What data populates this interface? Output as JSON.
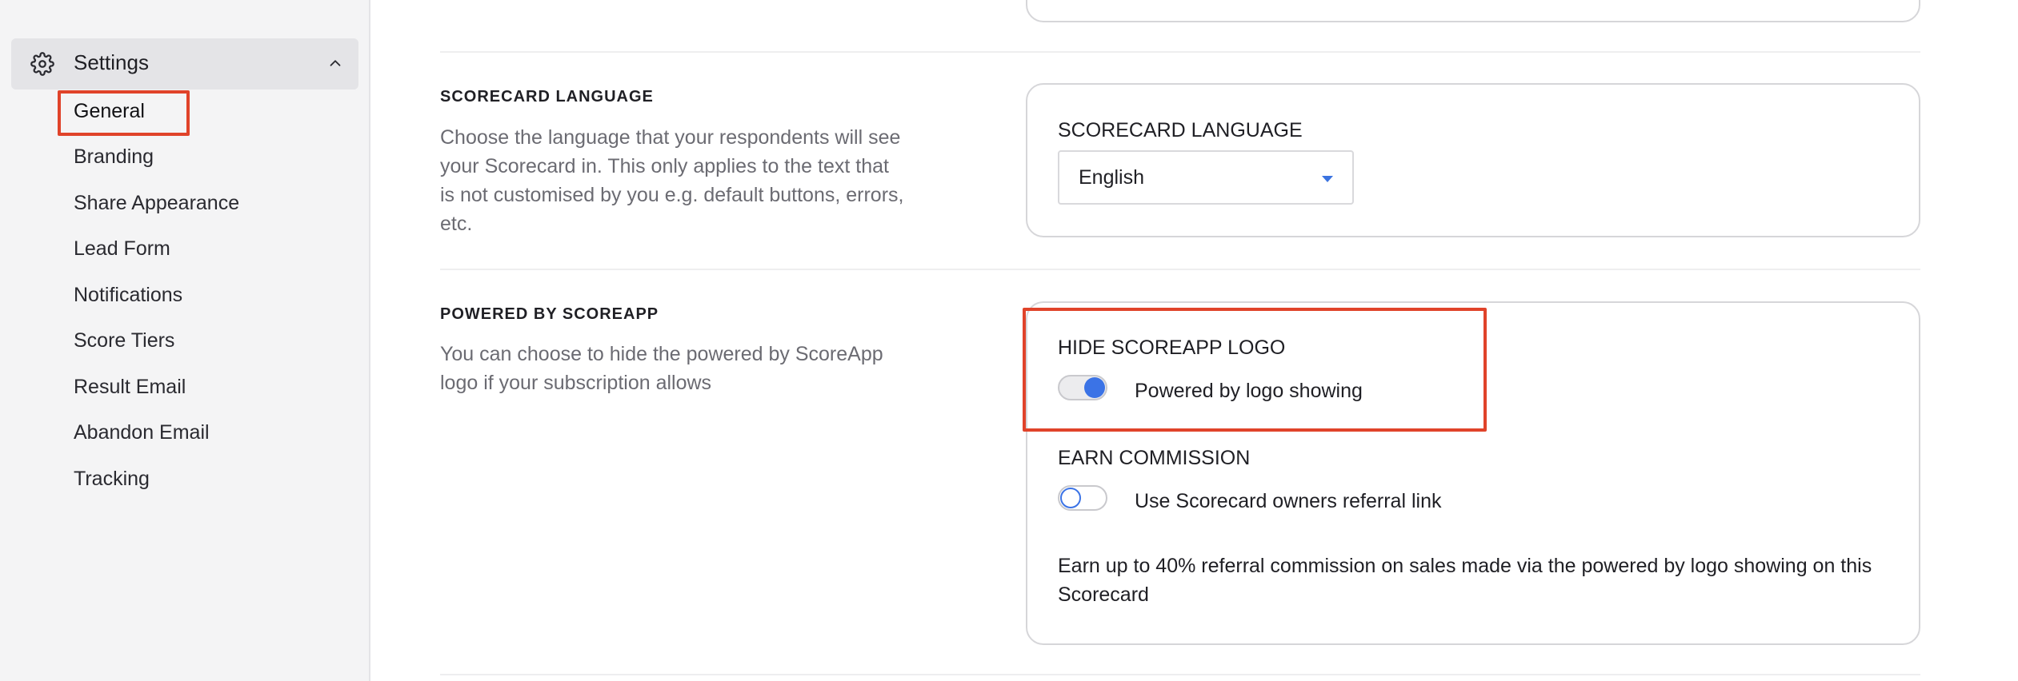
{
  "sidebar": {
    "settings_label": "Settings",
    "items": [
      {
        "label": "General",
        "selected": true
      },
      {
        "label": "Branding"
      },
      {
        "label": "Share Appearance"
      },
      {
        "label": "Lead Form"
      },
      {
        "label": "Notifications"
      },
      {
        "label": "Score Tiers"
      },
      {
        "label": "Result Email"
      },
      {
        "label": "Abandon Email"
      },
      {
        "label": "Tracking"
      }
    ]
  },
  "language_section": {
    "title": "SCORECARD LANGUAGE",
    "description": "Choose the language that your respondents will see your Scorecard in. This only applies to the text that is not customised by you e.g. default buttons, errors, etc.",
    "card_label": "SCORECARD LANGUAGE",
    "selected_language": "English"
  },
  "powered_section": {
    "title": "POWERED BY SCOREAPP",
    "description": "You can choose to hide the powered by ScoreApp logo if your subscription allows",
    "hide_logo_label": "HIDE SCOREAPP LOGO",
    "hide_logo_toggle_text": "Powered by logo showing",
    "hide_logo_toggle_on": true,
    "earn_commission_label": "EARN COMMISSION",
    "earn_commission_toggle_text": "Use Scorecard owners referral link",
    "earn_commission_toggle_on": false,
    "commission_note": "Earn up to 40% referral commission on sales made via the powered by logo showing on this Scorecard"
  },
  "colors": {
    "accent": "#3b73e6",
    "highlight": "#e0432a"
  }
}
